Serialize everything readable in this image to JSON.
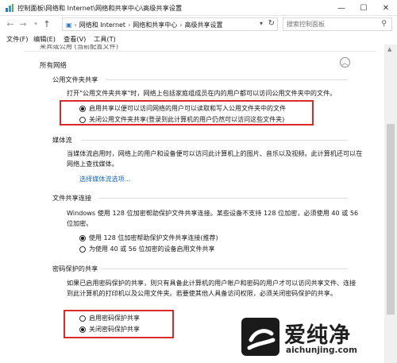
{
  "window": {
    "title": "控制面板\\网络和 Internet\\网络和共享中心\\高级共享设置",
    "controls": {
      "minimize": "—",
      "maximize": "☐",
      "close": "✕"
    }
  },
  "address_bar": {
    "crumbs": [
      "网络和 Internet",
      "网络和共享中心",
      "高级共享设置"
    ],
    "search_placeholder": "搜索控制面板"
  },
  "menu": {
    "items": [
      "文件(F)",
      "编辑(E)",
      "查看(V)",
      "工具(T)"
    ]
  },
  "content": {
    "cut_off_label": "来宾或公用 (当前配置文件)",
    "section_title": "所有网络",
    "public_folder": {
      "heading": "公用文件夹共享",
      "description": "打开\"公用文件夹共享\"时，网络上包括家庭组成员在内的用户都可以访问公用文件夹中的文件。",
      "options": [
        {
          "label": "启用共享以便可以访问网络的用户可以读取和写入公用文件夹中的文件",
          "selected": true
        },
        {
          "label": "关闭公用文件夹共享(登录到此计算机的用户仍然可以访问这些文件夹)",
          "selected": false
        }
      ]
    },
    "media": {
      "heading": "媒体流",
      "description": "当媒体流启用时，网络上的用户和设备便可以访问此计算机上的图片、音乐以及视频。此计算机还可以在网络上查找媒体。",
      "link": "选择媒体流选项..."
    },
    "file_sharing": {
      "heading": "文件共享连接",
      "description": "Windows 使用 128 位加密帮助保护文件共享连接。某些设备不支持 128 位加密，必须使用 40 或 56 位加密。",
      "options": [
        {
          "label": "使用 128 位加密帮助保护文件共享连接(推荐)",
          "selected": true
        },
        {
          "label": "为使用 40 或 56 位加密的设备启用文件共享",
          "selected": false
        }
      ]
    },
    "password": {
      "heading": "密码保护的共享",
      "description": "如果已启用密码保护的共享，则只有具备此计算机的用户帐户和密码的用户才可以访问共享文件、连接到此计算机的打印机以及公用文件夹。若要使其他人具备访问权限，必须关闭密码保护的共享。",
      "options": [
        {
          "label": "启用密码保护共享",
          "selected": false
        },
        {
          "label": "关闭密码保护共享",
          "selected": true
        }
      ]
    }
  },
  "watermark": {
    "text": "爱纯净",
    "url": "aichunjing.com"
  },
  "colors": {
    "highlight_box": "#d82b2b",
    "link": "#1565c0"
  }
}
